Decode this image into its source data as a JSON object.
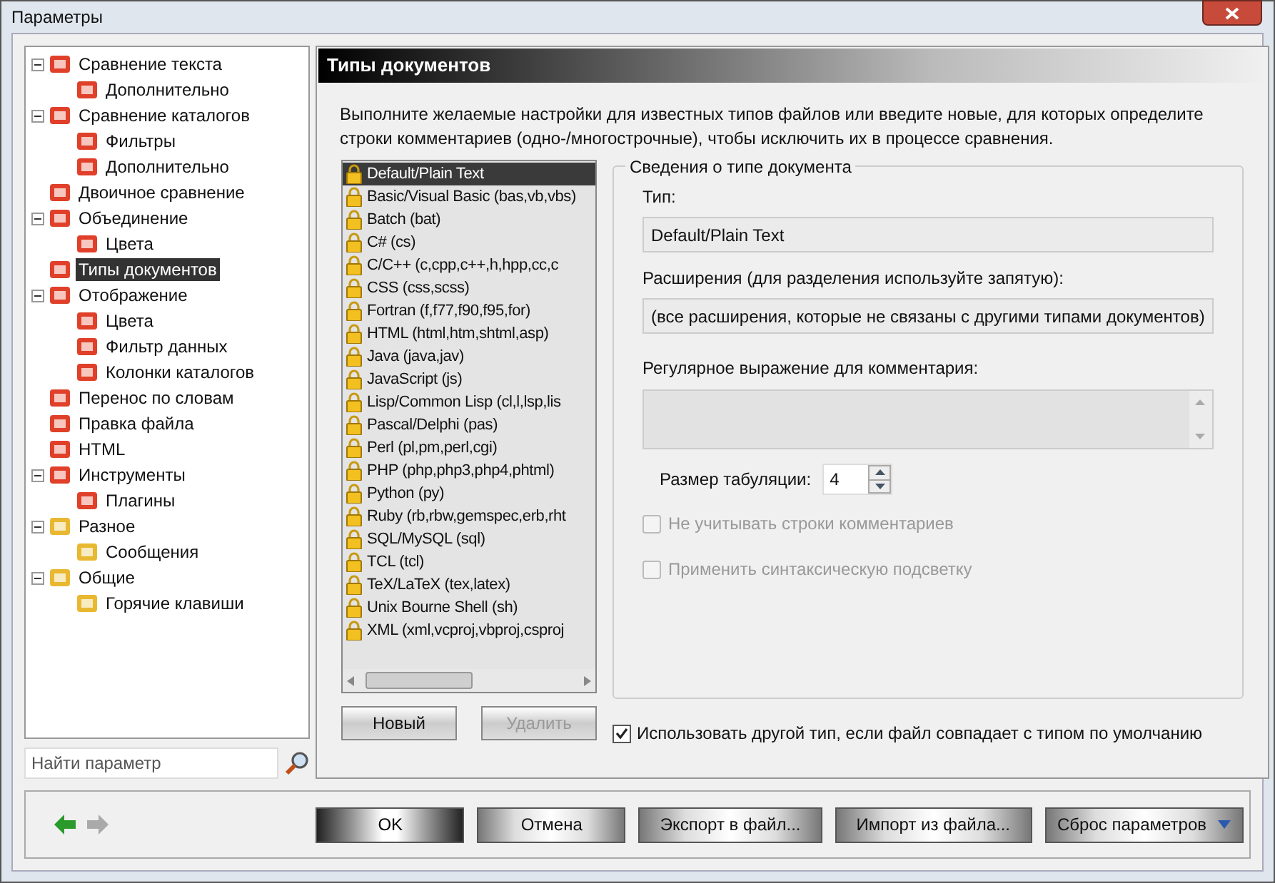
{
  "window": {
    "title": "Параметры"
  },
  "tree": [
    {
      "label": "Сравнение текста",
      "expanded": true,
      "selected": false,
      "children": [
        {
          "label": "Дополнительно",
          "selected": false
        }
      ]
    },
    {
      "label": "Сравнение каталогов",
      "expanded": true,
      "selected": false,
      "children": [
        {
          "label": "Фильтры",
          "selected": false
        },
        {
          "label": "Дополнительно",
          "selected": false
        }
      ]
    },
    {
      "label": "Двоичное сравнение",
      "selected": false
    },
    {
      "label": "Объединение",
      "expanded": true,
      "selected": false,
      "children": [
        {
          "label": "Цвета",
          "selected": false
        }
      ]
    },
    {
      "label": "Типы документов",
      "selected": true
    },
    {
      "label": "Отображение",
      "expanded": true,
      "selected": false,
      "children": [
        {
          "label": "Цвета",
          "selected": false
        },
        {
          "label": "Фильтр данных",
          "selected": false
        },
        {
          "label": "Колонки каталогов",
          "selected": false
        }
      ]
    },
    {
      "label": "Перенос по словам",
      "selected": false
    },
    {
      "label": "Правка файла",
      "selected": false
    },
    {
      "label": "HTML",
      "selected": false
    },
    {
      "label": "Инструменты",
      "expanded": true,
      "selected": false,
      "children": [
        {
          "label": "Плагины",
          "selected": false
        }
      ]
    },
    {
      "label": "Разное",
      "expanded": true,
      "selected": false,
      "children": [
        {
          "label": "Сообщения",
          "selected": false
        }
      ]
    },
    {
      "label": "Общие",
      "expanded": true,
      "selected": false,
      "children": [
        {
          "label": "Горячие клавиши",
          "selected": false
        }
      ]
    }
  ],
  "search": {
    "placeholder": "Найти параметр"
  },
  "panel": {
    "title": "Типы документов",
    "description": "Выполните желаемые настройки для известных типов файлов или введите новые, для которых определите строки комментариев (одно-/многострочные), чтобы исключить их в процессе сравнения."
  },
  "doc_types": [
    {
      "label": "Default/Plain Text",
      "selected": true
    },
    {
      "label": "Basic/Visual Basic (bas,vb,vbs)",
      "selected": false
    },
    {
      "label": "Batch (bat)",
      "selected": false
    },
    {
      "label": "C# (cs)",
      "selected": false
    },
    {
      "label": "C/C++ (c,cpp,c++,h,hpp,cc,c",
      "selected": false
    },
    {
      "label": "CSS (css,scss)",
      "selected": false
    },
    {
      "label": "Fortran (f,f77,f90,f95,for)",
      "selected": false
    },
    {
      "label": "HTML (html,htm,shtml,asp)",
      "selected": false
    },
    {
      "label": "Java (java,jav)",
      "selected": false
    },
    {
      "label": "JavaScript (js)",
      "selected": false
    },
    {
      "label": "Lisp/Common Lisp (cl,l,lsp,lis",
      "selected": false
    },
    {
      "label": "Pascal/Delphi (pas)",
      "selected": false
    },
    {
      "label": "Perl (pl,pm,perl,cgi)",
      "selected": false
    },
    {
      "label": "PHP (php,php3,php4,phtml)",
      "selected": false
    },
    {
      "label": "Python (py)",
      "selected": false
    },
    {
      "label": "Ruby (rb,rbw,gemspec,erb,rht",
      "selected": false
    },
    {
      "label": "SQL/MySQL (sql)",
      "selected": false
    },
    {
      "label": "TCL (tcl)",
      "selected": false
    },
    {
      "label": "TeX/LaTeX (tex,latex)",
      "selected": false
    },
    {
      "label": "Unix Bourne Shell (sh)",
      "selected": false
    },
    {
      "label": "XML (xml,vcproj,vbproj,csproj",
      "selected": false
    }
  ],
  "details": {
    "title": "Сведения о типе документа",
    "type_label": "Тип:",
    "type_value": "Default/Plain Text",
    "ext_label": "Расширения (для разделения используйте запятую):",
    "ext_value": "(все расширения, которые не связаны с другими типами документов)",
    "regex_label": "Регулярное выражение для комментария:",
    "tab_label": "Размер табуляции:",
    "tab_value": "4",
    "options": [
      {
        "label": "Не учитывать строки комментариев",
        "checked": false,
        "disabled": true
      },
      {
        "label": "Применить синтаксическую подсветку",
        "checked": false,
        "disabled": true
      }
    ]
  },
  "list_buttons": [
    {
      "label": "Новый",
      "disabled": false
    },
    {
      "label": "Удалить",
      "disabled": true
    }
  ],
  "use_other_type": {
    "label": "Использовать другой тип, если файл совпадает с типом по умолчанию",
    "checked": true
  },
  "footer_buttons": [
    {
      "label": "OK",
      "kind": "default"
    },
    {
      "label": "Отмена",
      "kind": "normal"
    },
    {
      "label": "Экспорт в файл...",
      "kind": "normal"
    },
    {
      "label": "Импорт из файла...",
      "kind": "normal"
    },
    {
      "label": "Сброс параметров",
      "kind": "dropdown"
    }
  ]
}
